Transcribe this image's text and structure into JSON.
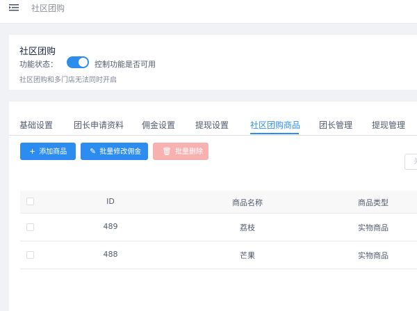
{
  "header": {
    "breadcrumb": "社区团购",
    "menu_icon": "menu-fold-icon"
  },
  "settings": {
    "title": "社区团购",
    "status_label": "功能状态：",
    "toggle_on": true,
    "toggle_desc": "控制功能是否可用",
    "note": "社区团购和多门店无法同时开启",
    "accent": "#2d8cf0"
  },
  "tabs": [
    {
      "label": "基础设置"
    },
    {
      "label": "团长申请资料"
    },
    {
      "label": "佣金设置"
    },
    {
      "label": "提现设置"
    },
    {
      "label": "社区团购商品"
    },
    {
      "label": "团长管理"
    },
    {
      "label": "提现管理"
    }
  ],
  "active_tab": "社区团购商品",
  "toolbar": {
    "add_label": "添加商品",
    "add_icon": "plus-icon",
    "edit_label": "批量修改佣金",
    "edit_icon": "edit-pen-icon",
    "delete_label": "批量删除",
    "delete_icon": "trash-icon",
    "search_partial": "关"
  },
  "table": {
    "columns": [
      "ID",
      "商品名称",
      "商品类型"
    ],
    "rows": [
      {
        "id": "489",
        "name": "荔枝",
        "type": "实物商品"
      },
      {
        "id": "488",
        "name": "芒果",
        "type": "实物商品"
      }
    ]
  }
}
